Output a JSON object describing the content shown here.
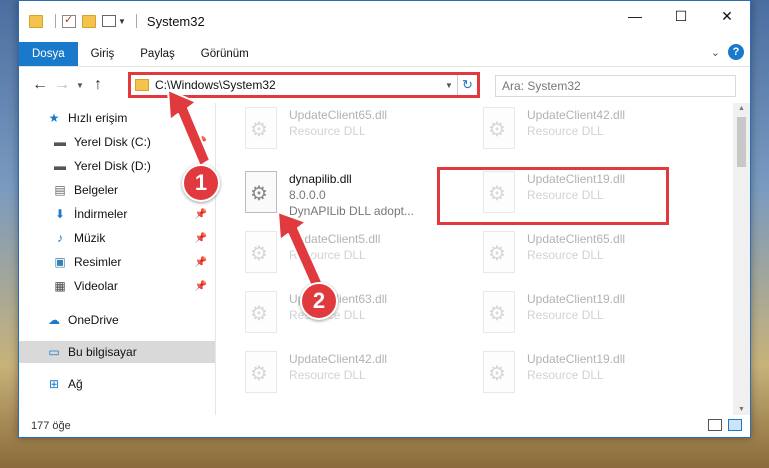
{
  "window": {
    "title": "System32",
    "controls": [
      "—",
      "☐",
      "✕"
    ]
  },
  "ribbon": {
    "tabs": [
      {
        "label": "Dosya",
        "active": true
      },
      {
        "label": "Giriş",
        "active": false
      },
      {
        "label": "Paylaş",
        "active": false
      },
      {
        "label": "Görünüm",
        "active": false
      }
    ],
    "expand_icon": "chevron-down-icon",
    "help_label": "?"
  },
  "address": {
    "path": "C:\\Windows\\System32",
    "search_placeholder": "Ara: System32"
  },
  "nav": {
    "items": [
      {
        "label": "Hızlı erişim",
        "icon": "star-icon",
        "pinned": false
      },
      {
        "label": "Yerel Disk (C:)",
        "icon": "drive-icon",
        "pinned": true
      },
      {
        "label": "Yerel Disk (D:)",
        "icon": "drive-icon",
        "pinned": false
      },
      {
        "label": "Belgeler",
        "icon": "documents-icon",
        "pinned": true
      },
      {
        "label": "İndirmeler",
        "icon": "download-icon",
        "pinned": true
      },
      {
        "label": "Müzik",
        "icon": "music-icon",
        "pinned": true
      },
      {
        "label": "Resimler",
        "icon": "pictures-icon",
        "pinned": true
      },
      {
        "label": "Videolar",
        "icon": "videos-icon",
        "pinned": true
      },
      {
        "label": "OneDrive",
        "icon": "cloud-icon",
        "pinned": false
      },
      {
        "label": "Bu bilgisayar",
        "icon": "computer-icon",
        "pinned": false,
        "selected": true
      },
      {
        "label": "Ağ",
        "icon": "network-icon",
        "pinned": false
      }
    ]
  },
  "files": {
    "highlighted": {
      "name": "dynapilib.dll",
      "version": "8.0.0.0",
      "description": "DynAPILib DLL adopt..."
    },
    "left_column": [
      {
        "name": "UpdateClient65.dll",
        "desc": "Resource DLL"
      },
      {
        "name": "UpdateClient5.dll",
        "desc": "Resource DLL"
      },
      {
        "name": "UpdateClient63.dll",
        "desc": "Resource DLL"
      },
      {
        "name": "UpdateClient42.dll",
        "desc": "Resource DLL"
      }
    ],
    "right_column": [
      {
        "name": "UpdateClient42.dll",
        "desc": "Resource DLL"
      },
      {
        "name": "UpdateClient19.dll",
        "desc": "Resource DLL"
      },
      {
        "name": "UpdateClient65.dll",
        "desc": "Resource DLL"
      },
      {
        "name": "UpdateClient19.dll",
        "desc": "Resource DLL"
      },
      {
        "name": "UpdateClient19.dll",
        "desc": "Resource DLL"
      }
    ]
  },
  "status": {
    "item_count": "177 öğe"
  },
  "annotations": {
    "step1": "1",
    "step2": "2",
    "color": "#e0393e"
  }
}
